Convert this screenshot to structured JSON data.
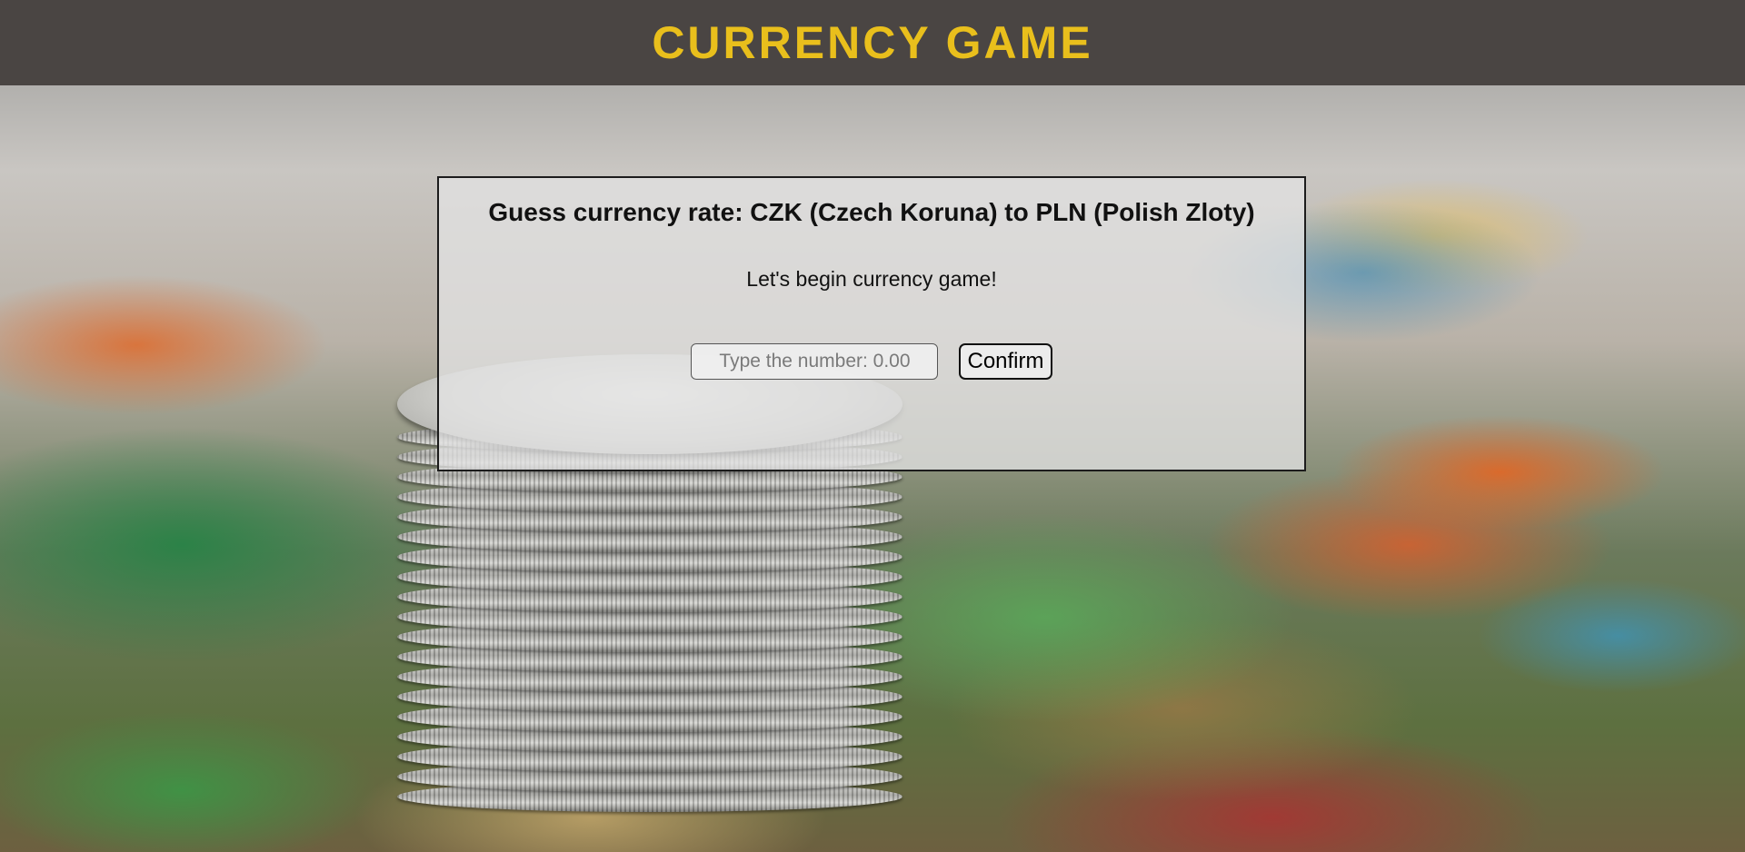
{
  "header": {
    "title": "CURRENCY GAME"
  },
  "game": {
    "question": "Guess currency rate: CZK (Czech Koruna) to PLN (Polish Zloty)",
    "message": "Let's begin currency game!",
    "input": {
      "value": "",
      "placeholder": "Type the number: 0.00"
    },
    "confirm_label": "Confirm"
  },
  "colors": {
    "header_bg": "#4a4543",
    "title": "#e9bf1c",
    "panel_border": "#1c1c1c"
  }
}
